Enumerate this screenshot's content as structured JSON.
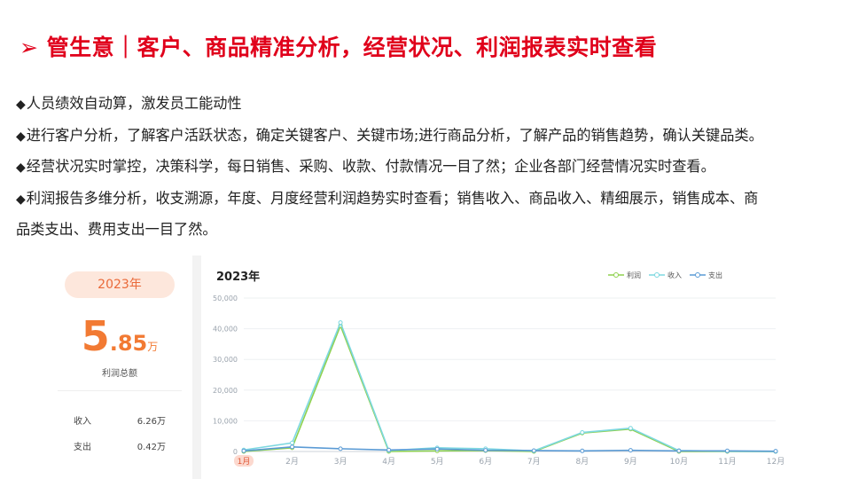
{
  "header": {
    "marker": "➢",
    "title": "管生意｜客户、商品精准分析，经营状况、利润报表实时查看"
  },
  "bullets": [
    {
      "marker": "◆",
      "text": "人员绩效自动算，激发员工能动性"
    },
    {
      "marker": "◆",
      "text": "进行客户分析，了解客户活跃状态，确定关键客户、关键市场;进行商品分析，了解产品的销售趋势，确认关键品类。"
    },
    {
      "marker": "◆",
      "text": "经营状况实时掌控，决策科学，每日销售、采购、收款、付款情况一目了然；企业各部门经营情况实时查看。"
    },
    {
      "marker": "◆",
      "text": "利润报告多维分析，收支溯源，年度、月度经营利润趋势实时查看；销售收入、商品收入、精细展示，销售成本、商",
      "cont": "品类支出、费用支出一目了然。"
    }
  ],
  "summary": {
    "year": "2023年",
    "big_int": "5",
    "big_dec": ".85",
    "big_unit": "万",
    "big_label": "利润总额",
    "rows": [
      {
        "label": "收入",
        "value": "6.26万"
      },
      {
        "label": "支出",
        "value": "0.42万"
      }
    ]
  },
  "colors": {
    "title": "#e0001b",
    "accent": "#f27a33",
    "profit": "#8fd14f",
    "income": "#7dd8e0",
    "expense": "#5b9bd5"
  },
  "chart_data": {
    "type": "line",
    "title": "2023年",
    "categories": [
      "1月",
      "2月",
      "3月",
      "4月",
      "5月",
      "6月",
      "7月",
      "8月",
      "9月",
      "10月",
      "11月",
      "12月"
    ],
    "highlight_category": "1月",
    "ylim": [
      0,
      50000
    ],
    "yticks": [
      0,
      10000,
      20000,
      30000,
      40000,
      50000
    ],
    "ytick_labels": [
      "0",
      "10,000",
      "20,000",
      "30,000",
      "40,000",
      "50,000"
    ],
    "legend_position": "top-right",
    "series": [
      {
        "name": "利润",
        "color": "#8fd14f",
        "values": [
          0,
          1200,
          41000,
          0,
          200,
          300,
          0,
          6000,
          7300,
          0,
          0,
          0
        ]
      },
      {
        "name": "收入",
        "color": "#7dd8e0",
        "values": [
          500,
          2800,
          42000,
          300,
          1200,
          900,
          200,
          6200,
          7600,
          300,
          100,
          0
        ]
      },
      {
        "name": "支出",
        "color": "#5b9bd5",
        "values": [
          200,
          1500,
          900,
          500,
          800,
          400,
          300,
          200,
          400,
          200,
          200,
          100
        ]
      }
    ]
  }
}
